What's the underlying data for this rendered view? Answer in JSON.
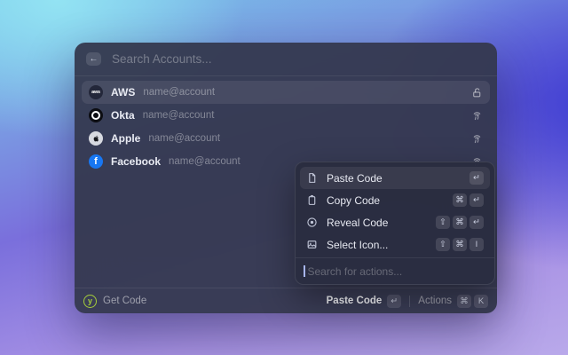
{
  "colors": {
    "accent_green": "#a5cd3b",
    "facebook_blue": "#1877f2",
    "window_bg": "#33374d",
    "panel_bg": "#2a2d40",
    "selection": "rgba(255,255,255,0.08)"
  },
  "window": {
    "back_icon_glyph": "←",
    "search": {
      "placeholder": "Search Accounts..."
    },
    "accounts": [
      {
        "name": "AWS",
        "subtitle": "name@account",
        "avatar_text": "aws",
        "right_icon": "lock-open-icon",
        "selected": true
      },
      {
        "name": "Okta",
        "subtitle": "name@account",
        "avatar_text": "",
        "right_icon": "fingerprint-icon",
        "selected": false
      },
      {
        "name": "Apple",
        "subtitle": "name@account",
        "avatar_text": "",
        "right_icon": "fingerprint-icon",
        "selected": false
      },
      {
        "name": "Facebook",
        "subtitle": "name@account",
        "avatar_text": "f",
        "right_icon": "fingerprint-icon",
        "selected": false
      }
    ],
    "footer": {
      "logo_glyph": "y",
      "app_action": "Get Code",
      "primary_action": "Paste Code",
      "primary_keys": [
        "↵"
      ],
      "actions_label": "Actions",
      "actions_keys": [
        "⌘",
        "K"
      ]
    }
  },
  "actions_menu": {
    "items": [
      {
        "label": "Paste Code",
        "icon": "file-icon",
        "keys": [
          "↵"
        ],
        "selected": true
      },
      {
        "label": "Copy Code",
        "icon": "clipboard-icon",
        "keys": [
          "⌘",
          "↵"
        ],
        "selected": false
      },
      {
        "label": "Reveal Code",
        "icon": "eye-icon",
        "keys": [
          "⇧",
          "⌘",
          "↵"
        ],
        "selected": false
      },
      {
        "label": "Select Icon...",
        "icon": "image-icon",
        "keys": [
          "⇧",
          "⌘",
          "I"
        ],
        "selected": false
      }
    ],
    "search": {
      "placeholder": "Search for actions..."
    }
  }
}
